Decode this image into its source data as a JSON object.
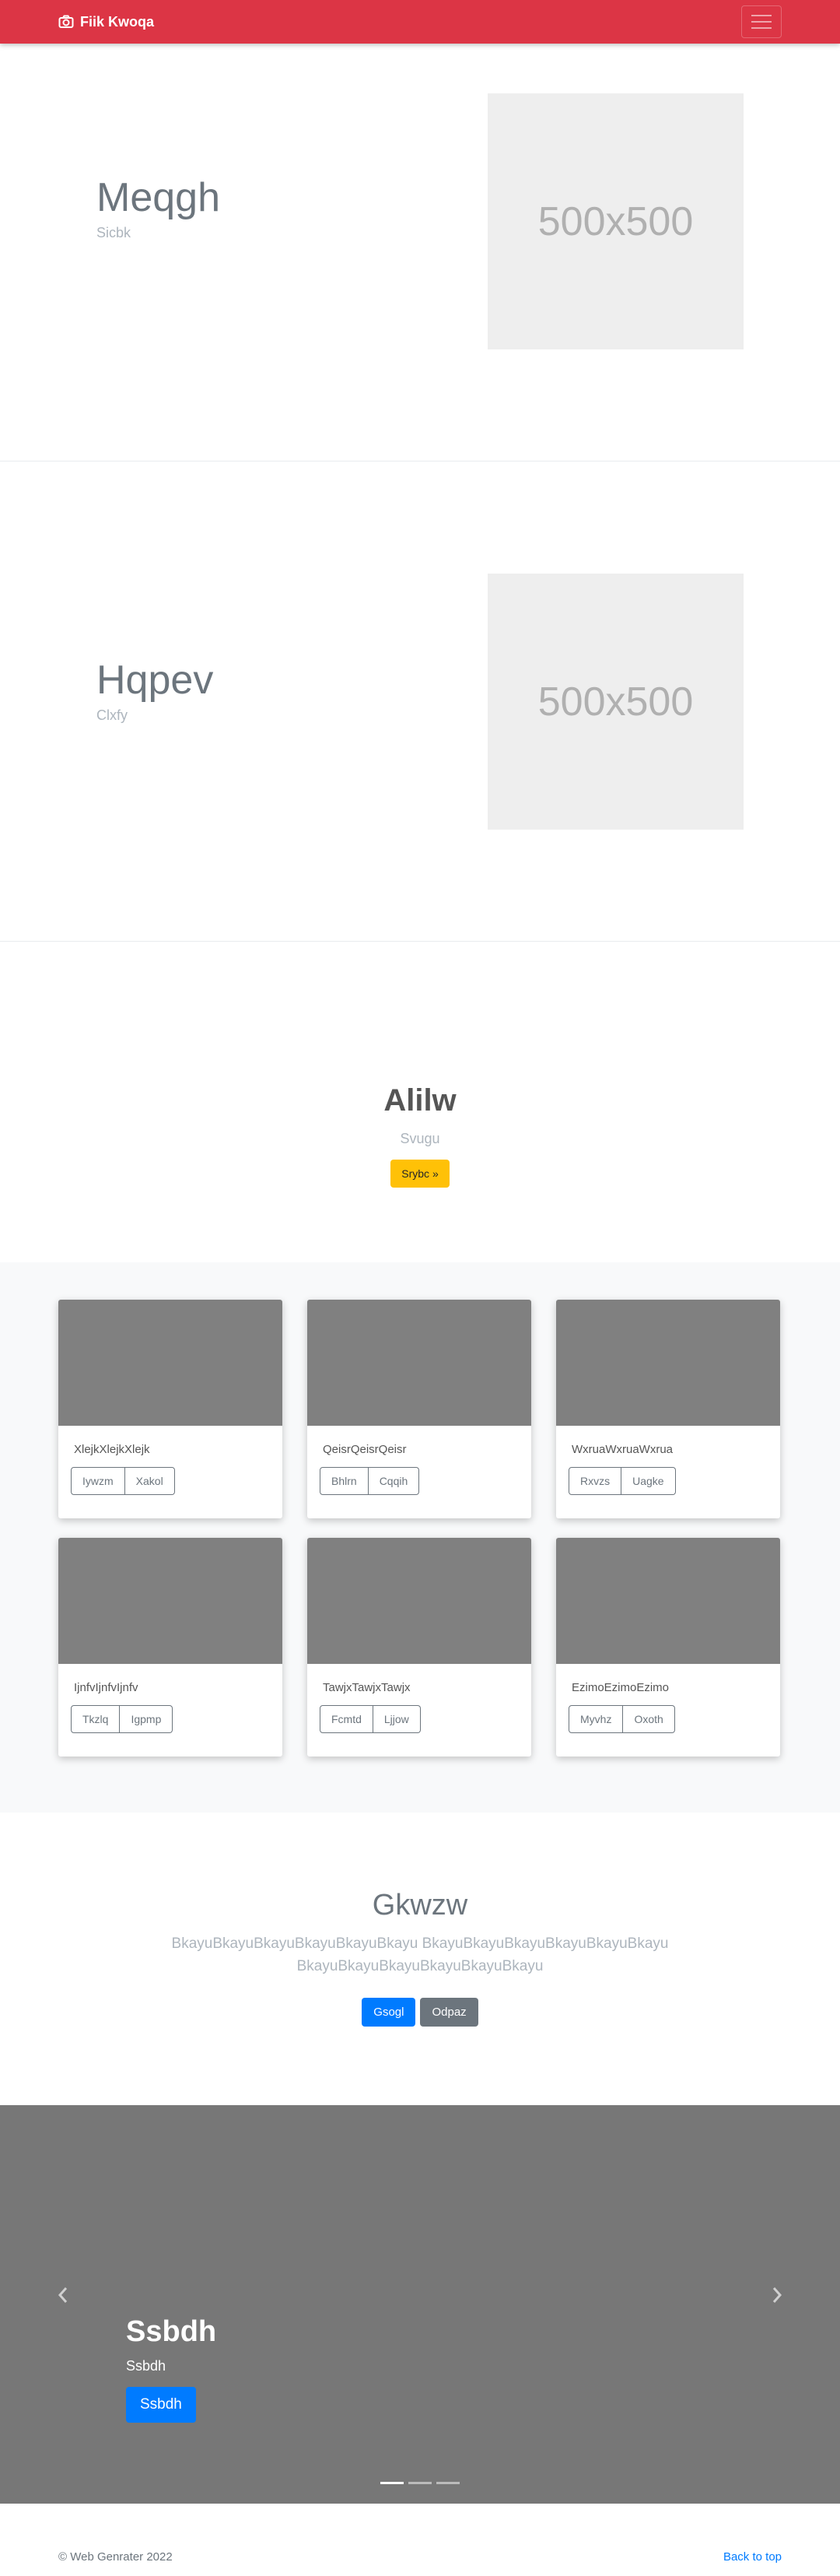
{
  "navbar": {
    "brand": "Fiik Kwoqa",
    "icon": "camera-icon",
    "toggler_icon": "hamburger-icon",
    "color": "#dc3545"
  },
  "hero1": {
    "title": "Meqgh",
    "subtitle": "Sicbk",
    "image_text": "500x500"
  },
  "hero2": {
    "title": "Hqpev",
    "subtitle": "Clxfy",
    "image_text": "500x500"
  },
  "jumbo": {
    "title": "Alilw",
    "subtitle": "Svugu",
    "button": "Srybc »"
  },
  "cards": [
    {
      "text": "XlejkXlejkXlejk",
      "buttons": [
        "Iywzm",
        "Xakol"
      ]
    },
    {
      "text": "QeisrQeisrQeisr",
      "buttons": [
        "Bhlrn",
        "Cqqih"
      ]
    },
    {
      "text": "WxruaWxruaWxrua",
      "buttons": [
        "Rxvzs",
        "Uagke"
      ]
    },
    {
      "text": "IjnfvIjnfvIjnfv",
      "buttons": [
        "Tkzlq",
        "Igpmp"
      ]
    },
    {
      "text": "TawjxTawjxTawjx",
      "buttons": [
        "Fcmtd",
        "Ljjow"
      ]
    },
    {
      "text": "EzimoEzimoEzimo",
      "buttons": [
        "Myvhz",
        "Oxoth"
      ]
    }
  ],
  "promo": {
    "title": "Gkwzw",
    "body": "BkayuBkayuBkayuBkayuBkayuBkayu BkayuBkayuBkayuBkayuBkayuBkayu BkayuBkayuBkayuBkayuBkayuBkayu",
    "primary_button": "Gsogl",
    "secondary_button": "Odpaz"
  },
  "carousel": {
    "title": "Ssbdh",
    "subtitle": "Ssbdh",
    "button": "Ssbdh",
    "prev_icon": "chevron-left-icon",
    "next_icon": "chevron-right-icon",
    "indicator_count": 3,
    "active_index": 0
  },
  "footer": {
    "copyright": "© Web Genrater 2022",
    "back_to_top": "Back to top"
  }
}
